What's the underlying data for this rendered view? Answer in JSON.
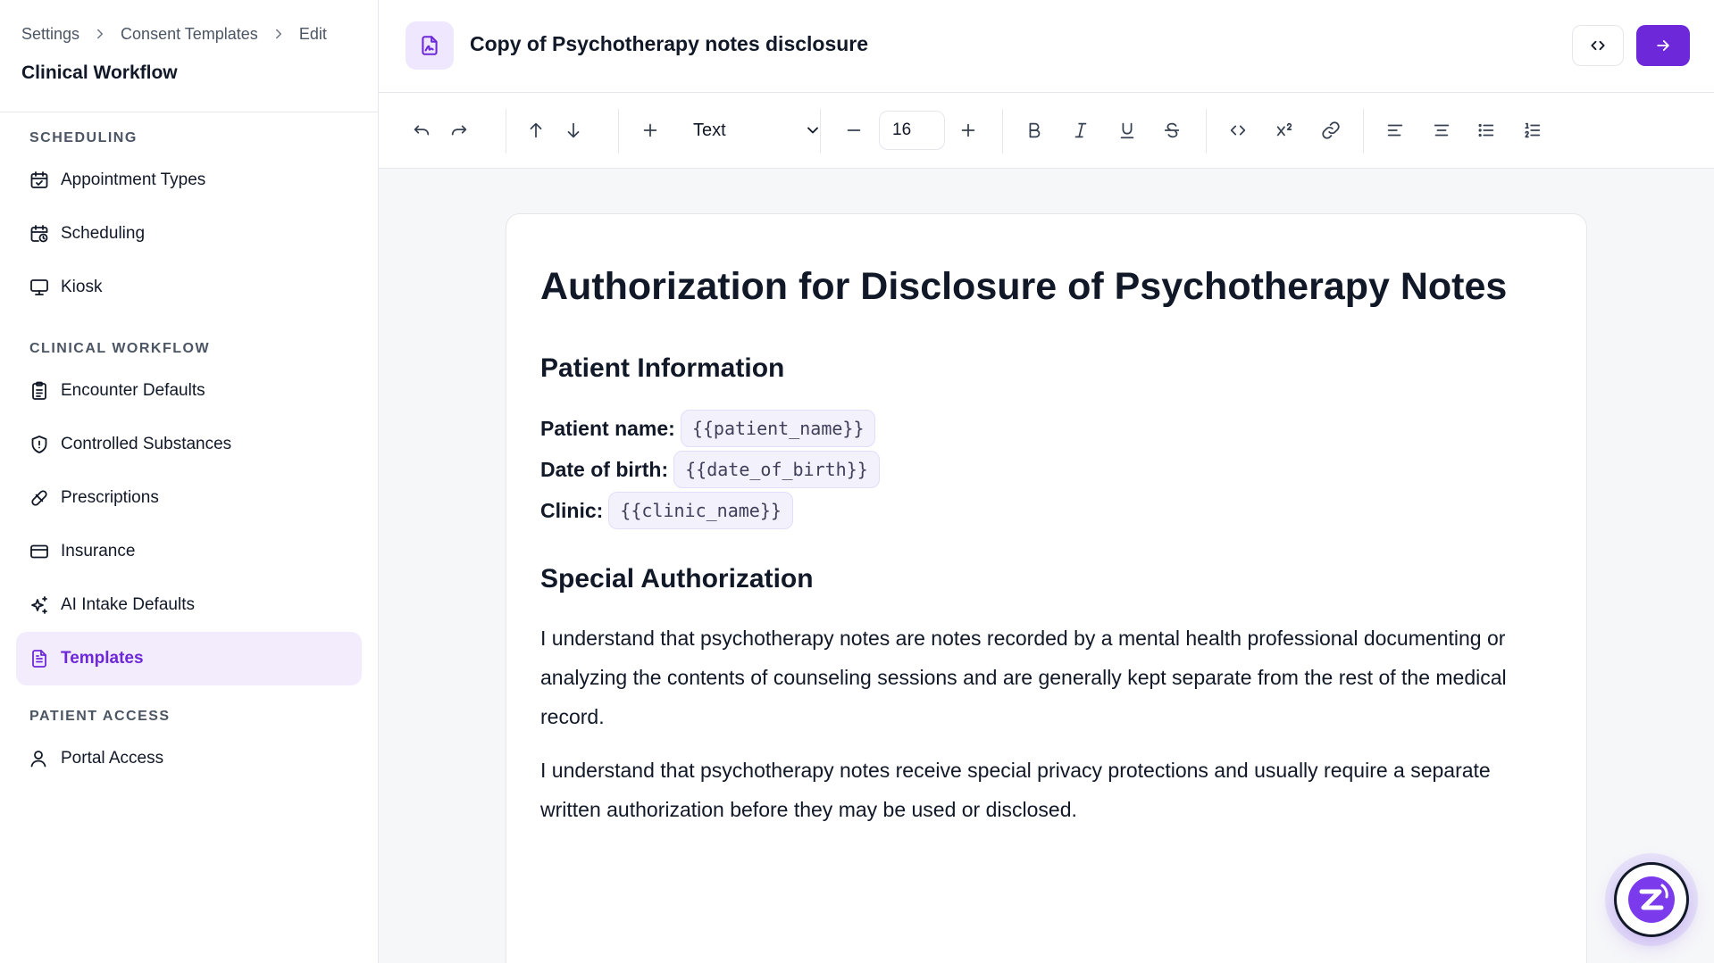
{
  "breadcrumb": {
    "items": [
      "Settings",
      "Consent Templates",
      "Edit"
    ]
  },
  "sidebar": {
    "title": "Clinical Workflow",
    "sections": [
      {
        "label": "SCHEDULING",
        "items": [
          {
            "label": "Appointment Types",
            "icon": "calendar-check-icon"
          },
          {
            "label": "Scheduling",
            "icon": "calendar-clock-icon"
          },
          {
            "label": "Kiosk",
            "icon": "monitor-icon"
          }
        ]
      },
      {
        "label": "CLINICAL WORKFLOW",
        "items": [
          {
            "label": "Encounter Defaults",
            "icon": "clipboard-icon"
          },
          {
            "label": "Controlled Substances",
            "icon": "shield-icon"
          },
          {
            "label": "Prescriptions",
            "icon": "pill-icon"
          },
          {
            "label": "Insurance",
            "icon": "credit-card-icon"
          },
          {
            "label": "AI Intake Defaults",
            "icon": "sparkles-icon"
          },
          {
            "label": "Templates",
            "icon": "file-text-icon",
            "active": true
          }
        ]
      },
      {
        "label": "PATIENT ACCESS",
        "items": [
          {
            "label": "Portal Access",
            "icon": "user-icon"
          }
        ]
      }
    ]
  },
  "header": {
    "title": "Copy of Psychotherapy notes disclosure",
    "icon": "file-signature-icon"
  },
  "toolbar": {
    "block_type": "Text",
    "font_size": "16",
    "icons": [
      "undo-icon",
      "redo-icon",
      "move-up-icon",
      "move-down-icon",
      "add-block-icon",
      "font-size-decrease-icon",
      "font-size-increase-icon",
      "bold-icon",
      "italic-icon",
      "underline-icon",
      "strikethrough-icon",
      "code-icon",
      "superscript-icon",
      "link-icon",
      "align-left-icon",
      "align-center-icon",
      "bullet-list-icon",
      "numbered-list-icon"
    ]
  },
  "document": {
    "title": "Authorization for Disclosure of Psychotherapy Notes",
    "section1_heading": "Patient Information",
    "fields": [
      {
        "label": "Patient name:",
        "variable": "{{patient_name}}"
      },
      {
        "label": "Date of birth:",
        "variable": "{{date_of_birth}}"
      },
      {
        "label": "Clinic:",
        "variable": "{{clinic_name}}"
      }
    ],
    "section2_heading": "Special Authorization",
    "paragraphs": [
      "I understand that psychotherapy notes are notes recorded by a mental health professional documenting or analyzing the contents of counseling sessions and are generally kept separate from the rest of the medical record.",
      "I understand that psychotherapy notes receive special privacy protections and usually require a separate written authorization before they may be used or disclosed."
    ]
  },
  "colors": {
    "accent": "#6d28d9",
    "active_bg": "#f3ecfd",
    "chip_bg": "#f2f1fc",
    "canvas_bg": "#f6f7f9"
  }
}
